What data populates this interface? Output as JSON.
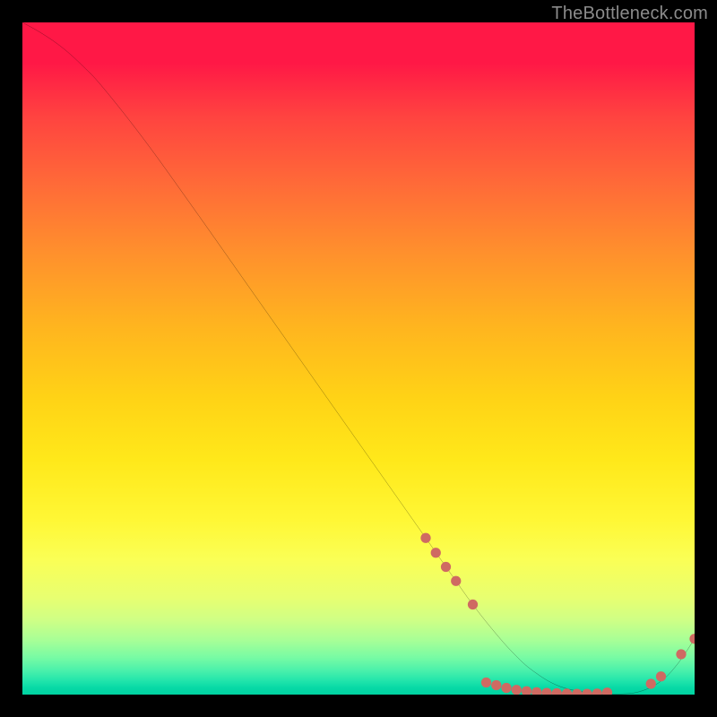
{
  "watermark": "TheBottleneck.com",
  "colors": {
    "page_bg": "#000000",
    "curve_stroke": "#000000",
    "marker_fill": "#cf6a62",
    "watermark_text": "#8b8b8b"
  },
  "chart_data": {
    "type": "line",
    "title": "",
    "xlabel": "",
    "ylabel": "",
    "xlim": [
      0,
      100
    ],
    "ylim": [
      0,
      100
    ],
    "grid": false,
    "series": [
      {
        "name": "curve",
        "x": [
          0,
          3,
          6,
          9,
          12,
          18,
          25,
          35,
          45,
          55,
          60,
          64,
          67,
          70,
          73,
          76,
          80,
          85,
          89,
          92,
          95,
          97.5,
          100
        ],
        "y": [
          100,
          98.3,
          96.2,
          93.5,
          90.3,
          82.7,
          73.0,
          58.8,
          44.6,
          30.4,
          23.3,
          17.6,
          13.4,
          9.6,
          6.2,
          3.5,
          1.2,
          0.2,
          0.1,
          0.5,
          2.0,
          4.6,
          8.3
        ]
      }
    ],
    "markers": [
      {
        "x": 60.0,
        "y": 23.3
      },
      {
        "x": 61.5,
        "y": 21.1
      },
      {
        "x": 63.0,
        "y": 19.0
      },
      {
        "x": 64.5,
        "y": 16.9
      },
      {
        "x": 67.0,
        "y": 13.4
      },
      {
        "x": 69.0,
        "y": 1.8
      },
      {
        "x": 70.5,
        "y": 1.4
      },
      {
        "x": 72.0,
        "y": 1.0
      },
      {
        "x": 73.5,
        "y": 0.7
      },
      {
        "x": 75.0,
        "y": 0.5
      },
      {
        "x": 76.5,
        "y": 0.35
      },
      {
        "x": 78.0,
        "y": 0.25
      },
      {
        "x": 79.5,
        "y": 0.2
      },
      {
        "x": 81.0,
        "y": 0.15
      },
      {
        "x": 82.5,
        "y": 0.12
      },
      {
        "x": 84.0,
        "y": 0.12
      },
      {
        "x": 85.5,
        "y": 0.15
      },
      {
        "x": 87.0,
        "y": 0.3
      },
      {
        "x": 93.5,
        "y": 1.6
      },
      {
        "x": 95.0,
        "y": 2.7
      },
      {
        "x": 98.0,
        "y": 6.0
      },
      {
        "x": 100.0,
        "y": 8.3
      }
    ]
  }
}
